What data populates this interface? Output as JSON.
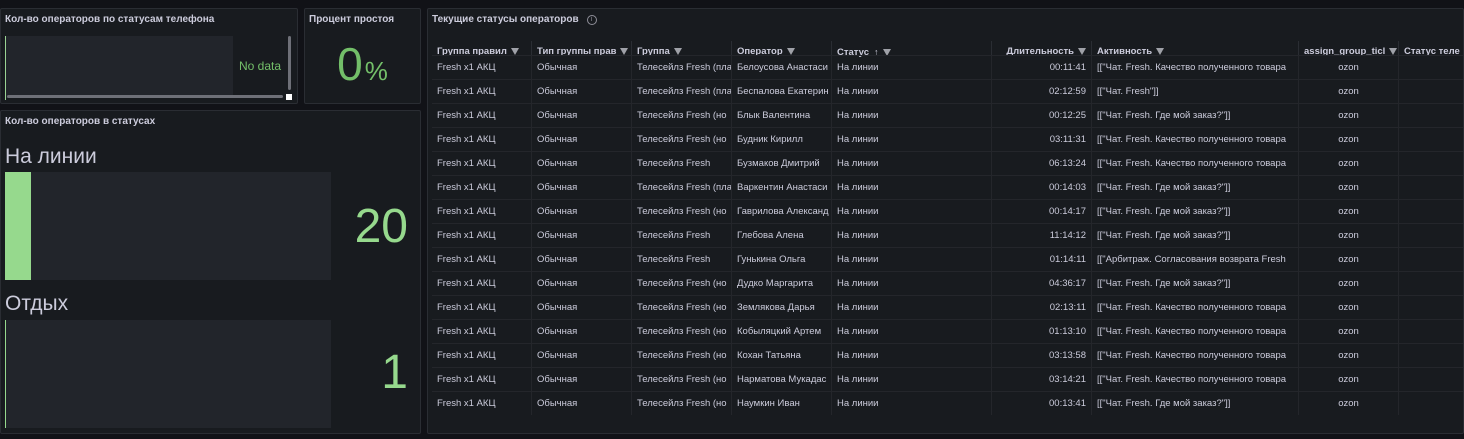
{
  "panel_phone_status": {
    "title": "Кол-во операторов по статусам телефона",
    "no_data": "No data"
  },
  "panel_idle": {
    "title": "Процент простоя",
    "value": "0",
    "unit": "%"
  },
  "panel_status_counts": {
    "title": "Кол-во операторов в статусах",
    "max": 20,
    "items": [
      {
        "label": "На линии",
        "value": "20"
      },
      {
        "label": "Отдых",
        "value": "1"
      }
    ]
  },
  "table": {
    "title": "Текущие статусы операторов",
    "columns": [
      "Группа правил",
      "Тип группы прав",
      "Группа",
      "Оператор",
      "Статус",
      "Длительность",
      "Активность",
      "assign_group_ticl",
      "Статус теле"
    ],
    "rows": [
      [
        "Fresh x1 АКЦ",
        "Обычная",
        "Телесейлз Fresh (пла",
        "Белоусова Анастаси",
        "На линии",
        "00:11:41",
        "[[\"Чат. Fresh. Качество полученного товара",
        "ozon",
        ""
      ],
      [
        "Fresh x1 АКЦ",
        "Обычная",
        "Телесейлз Fresh (пла",
        "Беспалова Екатерин",
        "На линии",
        "02:12:59",
        "[[\"Чат. Fresh\"]]",
        "ozon",
        ""
      ],
      [
        "Fresh x1 АКЦ",
        "Обычная",
        "Телесейлз Fresh (но",
        "Блык Валентина",
        "На линии",
        "00:12:25",
        "[[\"Чат. Fresh. Где мой заказ?\"]]",
        "ozon",
        ""
      ],
      [
        "Fresh x1 АКЦ",
        "Обычная",
        "Телесейлз Fresh (но",
        "Будник Кирилл",
        "На линии",
        "03:11:31",
        "[[\"Чат. Fresh. Качество полученного товара",
        "ozon",
        ""
      ],
      [
        "Fresh x1 АКЦ",
        "Обычная",
        "Телесейлз Fresh",
        "Бузмаков Дмитрий",
        "На линии",
        "06:13:24",
        "[[\"Чат. Fresh. Качество полученного товара",
        "ozon",
        ""
      ],
      [
        "Fresh x1 АКЦ",
        "Обычная",
        "Телесейлз Fresh (пла",
        "Варкентин Анастаси",
        "На линии",
        "00:14:03",
        "[[\"Чат. Fresh. Где мой заказ?\"]]",
        "ozon",
        ""
      ],
      [
        "Fresh x1 АКЦ",
        "Обычная",
        "Телесейлз Fresh (но",
        "Гаврилова Александ",
        "На линии",
        "00:14:17",
        "[[\"Чат. Fresh. Где мой заказ?\"]]",
        "ozon",
        ""
      ],
      [
        "Fresh x1 АКЦ",
        "Обычная",
        "Телесейлз Fresh",
        "Глебова Алена",
        "На линии",
        "11:14:12",
        "[[\"Чат. Fresh. Где мой заказ?\"]]",
        "ozon",
        ""
      ],
      [
        "Fresh x1 АКЦ",
        "Обычная",
        "Телесейлз Fresh",
        "Гунькина Ольга",
        "На линии",
        "01:14:11",
        "[[\"Арбитраж. Согласования возврата Fresh",
        "ozon",
        ""
      ],
      [
        "Fresh x1 АКЦ",
        "Обычная",
        "Телесейлз Fresh (но",
        "Дудко Маргарита",
        "На линии",
        "04:36:17",
        "[[\"Чат. Fresh. Где мой заказ?\"]]",
        "ozon",
        ""
      ],
      [
        "Fresh x1 АКЦ",
        "Обычная",
        "Телесейлз Fresh (но",
        "Землякова Дарья",
        "На линии",
        "02:13:11",
        "[[\"Чат. Fresh. Качество полученного товара",
        "ozon",
        ""
      ],
      [
        "Fresh x1 АКЦ",
        "Обычная",
        "Телесейлз Fresh (но",
        "Кобыляцкий Артем",
        "На линии",
        "01:13:10",
        "[[\"Чат. Fresh. Качество полученного товара",
        "ozon",
        ""
      ],
      [
        "Fresh x1 АКЦ",
        "Обычная",
        "Телесейлз Fresh (но",
        "Кохан Татьяна",
        "На линии",
        "03:13:58",
        "[[\"Чат. Fresh. Качество полученного товара",
        "ozon",
        ""
      ],
      [
        "Fresh x1 АКЦ",
        "Обычная",
        "Телесейлз Fresh (но",
        "Нарматова Мукадас",
        "На линии",
        "03:14:21",
        "[[\"Чат. Fresh. Качество полученного товара",
        "ozon",
        ""
      ],
      [
        "Fresh x1 АКЦ",
        "Обычная",
        "Телесейлз Fresh (но",
        "Наумкин Иван",
        "На линии",
        "00:13:41",
        "[[\"Чат. Fresh. Где мой заказ?\"]]",
        "ozon",
        ""
      ]
    ]
  }
}
